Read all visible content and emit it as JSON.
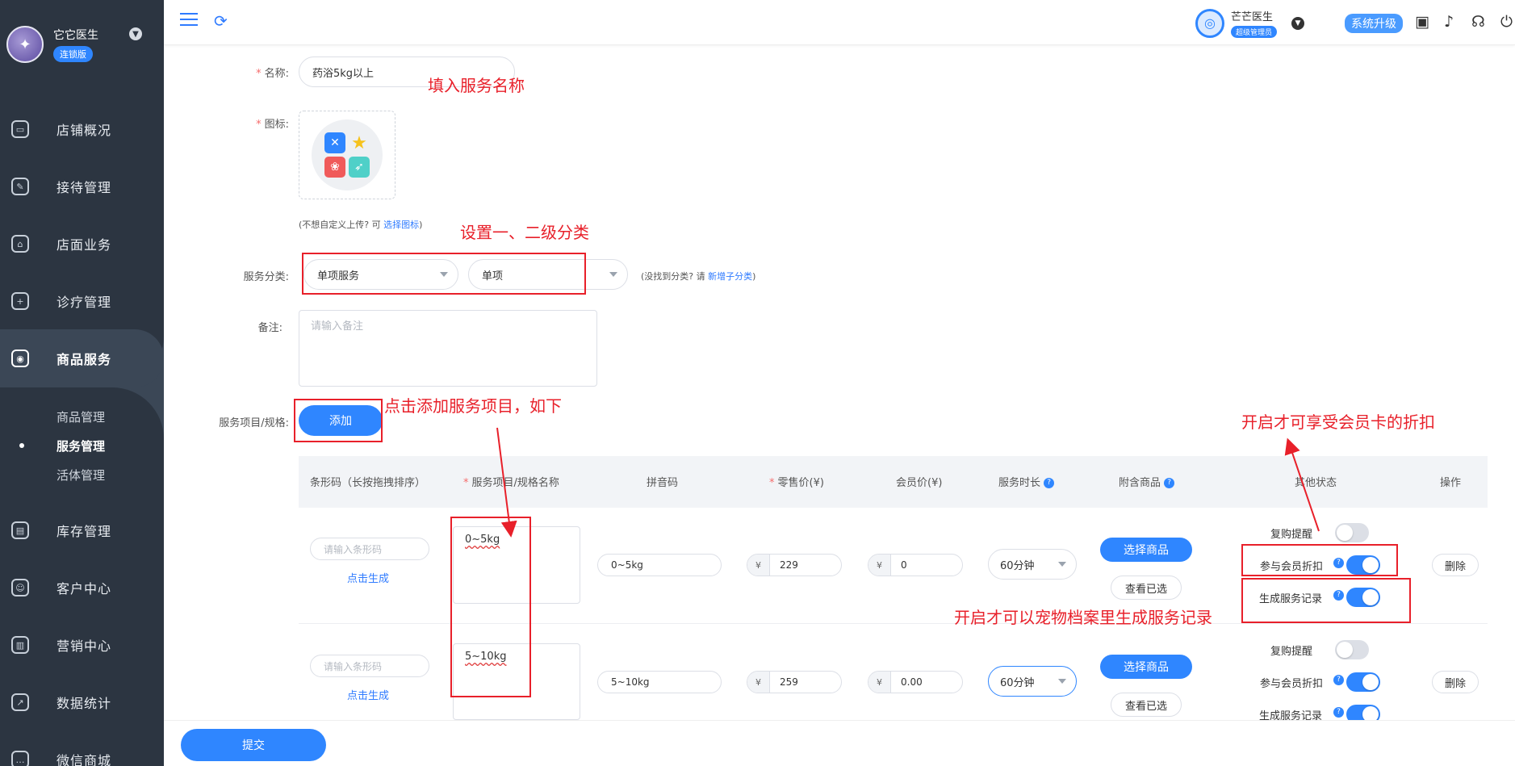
{
  "brand": {
    "name": "它它医生",
    "badge": "连锁版"
  },
  "sidebar": {
    "items": [
      {
        "label": "店铺概况",
        "icon": "monitor-icon"
      },
      {
        "label": "接待管理",
        "icon": "clipboard-icon"
      },
      {
        "label": "店面业务",
        "icon": "home-icon"
      },
      {
        "label": "诊疗管理",
        "icon": "medkit-icon"
      },
      {
        "label": "商品服务",
        "icon": "bag-icon"
      },
      {
        "label": "库存管理",
        "icon": "box-icon"
      },
      {
        "label": "客户中心",
        "icon": "user-icon"
      },
      {
        "label": "营销中心",
        "icon": "chart-bar-icon"
      },
      {
        "label": "数据统计",
        "icon": "stats-icon"
      },
      {
        "label": "微信商城",
        "icon": "chat-icon"
      }
    ],
    "subitems": [
      "商品管理",
      "服务管理",
      "活体管理"
    ]
  },
  "topbar": {
    "user_name": "芒芒医生",
    "user_role": "超级管理员",
    "upgrade": "系统升级"
  },
  "form": {
    "name_label": "名称:",
    "name_value": "药浴5kg以上",
    "icon_label": "图标:",
    "icon_hint_prefix": "(不想自定义上传? 可 ",
    "icon_hint_link": "选择图标",
    "icon_hint_suffix": ")",
    "category_label": "服务分类:",
    "category_1": "单项服务",
    "category_2": "单项",
    "category_hint_prefix": "(没找到分类? 请 ",
    "category_hint_link": "新增子分类",
    "category_hint_suffix": ")",
    "remark_label": "备注:",
    "remark_placeholder": "请输入备注",
    "items_label": "服务项目/规格:",
    "add_button": "添加",
    "submit_button": "提交"
  },
  "table": {
    "headers": {
      "barcode": "条形码（长按拖拽排序）",
      "name": "服务项目/规格名称",
      "pinyin": "拼音码",
      "retail": "零售价(¥)",
      "member": "会员价(¥)",
      "duration": "服务时长",
      "attached": "附含商品",
      "status": "其他状态",
      "action": "操作"
    },
    "barcode_placeholder": "请输入条形码",
    "generate_link": "点击生成",
    "select_goods": "选择商品",
    "view_selected": "查看已选",
    "delete": "删除",
    "currency": "¥",
    "status_labels": [
      "复购提醒",
      "参与会员折扣",
      "生成服务记录"
    ],
    "rows": [
      {
        "name": "0~5kg",
        "pinyin": "0~5kg",
        "retail": "229",
        "member": "0",
        "duration": "60分钟",
        "toggles": [
          false,
          true,
          true
        ]
      },
      {
        "name": "5~10kg",
        "pinyin": "5~10kg",
        "retail": "259",
        "member": "0.00",
        "duration": "60分钟",
        "toggles": [
          false,
          true,
          true
        ]
      }
    ]
  },
  "annotations": {
    "name": "填入服务名称",
    "category": "设置一、二级分类",
    "add": "点击添加服务项目，如下",
    "discount": "开启才可享受会员卡的折扣",
    "record": "开启才可以宠物档案里生成服务记录"
  },
  "colors": {
    "accent": "#2f86ff",
    "annotation": "#e8202a",
    "sidebar": "#2c3541"
  }
}
